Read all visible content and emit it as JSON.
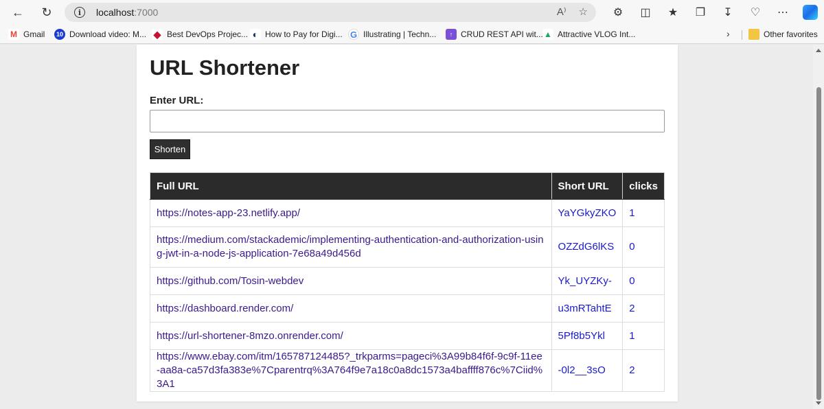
{
  "browser": {
    "address_host": "localhost",
    "address_port": ":7000",
    "read_aloud_icon": "A⁾",
    "bookmarks": [
      {
        "label": "Gmail",
        "icon": "M",
        "color": "#ea4335"
      },
      {
        "label": "Download video: M...",
        "icon": "10",
        "color": "#1a3bd6"
      },
      {
        "label": "Best DevOps Projec...",
        "icon": "◆",
        "color": "#c41230"
      },
      {
        "label": "How to Pay for Digi...",
        "icon": "◐",
        "color": "#1a2a5a"
      },
      {
        "label": "Illustrating  |  Techn...",
        "icon": "G",
        "color": "#4285f4"
      },
      {
        "label": "CRUD REST API wit...",
        "icon": "↑",
        "color": "#7b4fd6"
      },
      {
        "label": "Attractive VLOG Int...",
        "icon": "▲",
        "color": "#1fa463"
      }
    ],
    "other_favorites": "Other favorites"
  },
  "app": {
    "title": "URL Shortener",
    "input_label": "Enter URL:",
    "input_value": "",
    "button_label": "Shorten"
  },
  "table": {
    "headers": {
      "full": "Full URL",
      "short": "Short URL",
      "clicks": "clicks"
    },
    "rows": [
      {
        "full": "https://notes-app-23.netlify.app/",
        "short": "YaYGkyZKO",
        "clicks": "1"
      },
      {
        "full": "https://medium.com/stackademic/implementing-authentication-and-authorization-using-jwt-in-a-node-js-application-7e68a49d456d",
        "short": "OZZdG6lKS",
        "clicks": "0"
      },
      {
        "full": "https://github.com/Tosin-webdev",
        "short": "Yk_UYZKy-",
        "clicks": "0"
      },
      {
        "full": "https://dashboard.render.com/",
        "short": "u3mRTahtE",
        "clicks": "2"
      },
      {
        "full": "https://url-shortener-8mzo.onrender.com/",
        "short": "5Pf8b5Ykl",
        "clicks": "1"
      },
      {
        "full": "https://www.ebay.com/itm/165787124485?_trkparms=pageci%3A99b84f6f-9c9f-11ee-aa8a-ca57d3fa383e%7Cparentrq%3A764f9e7a18c0a8dc1573a4baffff876c%7Ciid%3A1",
        "short": "-0l2__3sO",
        "clicks": "2"
      }
    ]
  }
}
